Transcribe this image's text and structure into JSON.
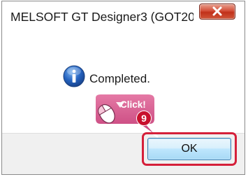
{
  "dialog": {
    "title": "MELSOFT GT Designer3 (GOT20...",
    "message": "Completed.",
    "ok_label": "OK"
  },
  "annotation": {
    "click_label": "Click!",
    "step_number": "9"
  },
  "icons": {
    "message_icon": "info-icon",
    "close_icon": "close-icon",
    "mouse_icon": "mouse-icon"
  },
  "colors": {
    "close_button": "#c7382a",
    "info_icon": "#1f5fb3",
    "highlight_border": "#d5203a",
    "callout_fill": "#d9598f",
    "ok_button_border": "#3c7fb1"
  }
}
